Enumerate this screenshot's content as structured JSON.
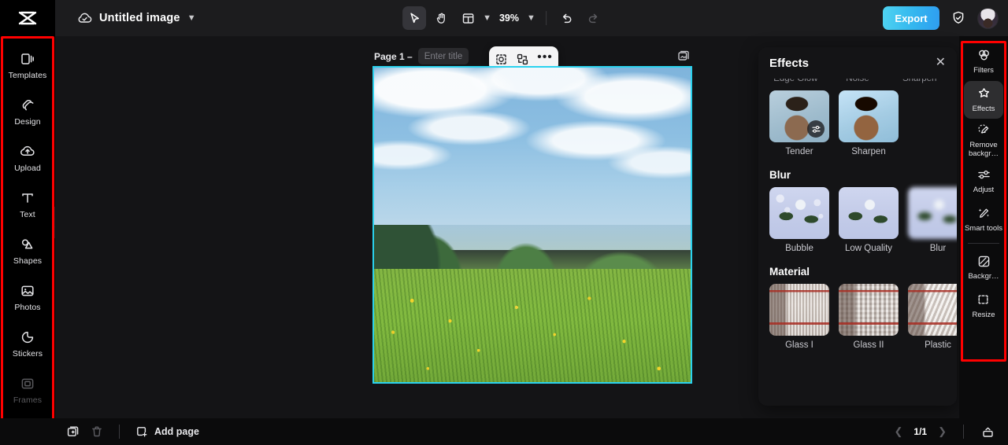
{
  "app": {
    "logo_icon": "capcut-logo-icon",
    "document_title": "Untitled image",
    "cloud_icon": "cloud-saved-icon",
    "title_chevron_icon": "chevron-down-icon"
  },
  "toolbar": {
    "select_icon": "cursor-arrow-icon",
    "hand_icon": "hand-pan-icon",
    "layout_icon": "layout-grid-icon",
    "layout_chevron_icon": "chevron-down-icon",
    "zoom_level": "39%",
    "zoom_chevron_icon": "chevron-down-icon",
    "undo_icon": "undo-icon",
    "redo_icon": "redo-icon",
    "export_label": "Export",
    "shield_icon": "shield-check-icon",
    "avatar_icon": "user-avatar"
  },
  "sidebar": {
    "items": [
      {
        "label": "Templates",
        "icon": "templates-icon"
      },
      {
        "label": "Design",
        "icon": "design-icon"
      },
      {
        "label": "Upload",
        "icon": "upload-cloud-icon"
      },
      {
        "label": "Text",
        "icon": "text-icon"
      },
      {
        "label": "Shapes",
        "icon": "shapes-icon"
      },
      {
        "label": "Photos",
        "icon": "photos-icon"
      },
      {
        "label": "Stickers",
        "icon": "stickers-icon"
      },
      {
        "label": "Frames",
        "icon": "frames-icon"
      }
    ],
    "collapse_icon": "chevron-right-icon"
  },
  "canvas": {
    "page_label": "Page 1 –",
    "title_placeholder": "Enter title",
    "layers_icon": "layers-icon",
    "float_toolbar": {
      "cutout_icon": "cutout-select-icon",
      "replace_icon": "replace-image-icon",
      "more_icon": "more-options-icon",
      "more_label": "•••"
    },
    "image_alt": "Bavarian village landscape with meadow and clouds"
  },
  "effects_panel": {
    "title": "Effects",
    "close_icon": "close-icon",
    "scrolled_labels": [
      "Edge Glow",
      "Noise",
      "Sharpen"
    ],
    "current_row": [
      {
        "label": "Tender",
        "selected": true,
        "overlay_icon": "adjust-sliders-icon"
      },
      {
        "label": "Sharpen",
        "selected": false
      }
    ],
    "sections": [
      {
        "title": "Blur",
        "items": [
          {
            "label": "Bubble"
          },
          {
            "label": "Low Quality"
          },
          {
            "label": "Blur"
          }
        ]
      },
      {
        "title": "Material",
        "items": [
          {
            "label": "Glass I"
          },
          {
            "label": "Glass II"
          },
          {
            "label": "Plastic"
          }
        ]
      }
    ]
  },
  "right_rail": {
    "items": [
      {
        "label": "Filters",
        "icon": "filters-icon",
        "active": false
      },
      {
        "label": "Effects",
        "icon": "effects-star-icon",
        "active": true
      },
      {
        "label": "Remove backgr…",
        "icon": "remove-background-icon",
        "active": false
      },
      {
        "label": "Adjust",
        "icon": "adjust-sliders-icon",
        "active": false
      },
      {
        "label": "Smart tools",
        "icon": "smart-tools-icon",
        "active": false
      },
      {
        "label": "Backgr…",
        "icon": "background-icon",
        "active": false
      },
      {
        "label": "Resize",
        "icon": "resize-icon",
        "active": false
      }
    ]
  },
  "bottom_bar": {
    "duplicate_icon": "duplicate-page-icon",
    "delete_icon": "trash-icon",
    "add_page_icon": "add-page-icon",
    "add_page_label": "Add page",
    "prev_icon": "chevron-left-icon",
    "page_indicator": "1/1",
    "next_icon": "chevron-right-icon",
    "tray_icon": "page-tray-icon"
  },
  "annotations": {
    "color": "#ff0000",
    "regions": [
      "left-sidebar",
      "right-rail",
      "tender-effect-thumbnail"
    ]
  }
}
